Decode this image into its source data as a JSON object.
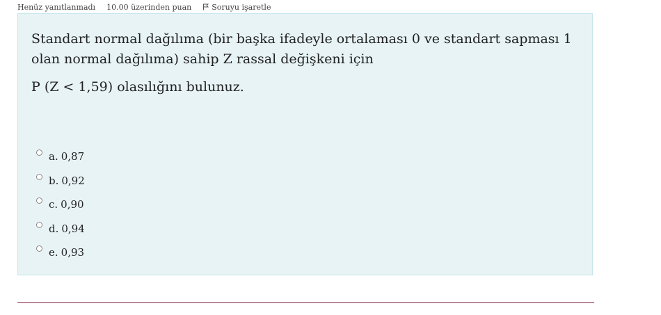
{
  "info": {
    "status": "Henüz yanıtlanmadı",
    "points": "10.00 üzerinden puan",
    "flag_label": "Soruyu işaretle"
  },
  "question": {
    "text": "Standart normal dağılıma (bir başka ifadeyle ortalaması 0 ve standart sapması 1 olan normal dağılıma) sahip Z rassal değişkeni için",
    "sub": "P (Z < 1,59) olasılığını bulunuz."
  },
  "answers": [
    {
      "prefix": "a.",
      "value": "0,87"
    },
    {
      "prefix": "b.",
      "value": "0,92"
    },
    {
      "prefix": "c.",
      "value": "0,90"
    },
    {
      "prefix": "d.",
      "value": "0,94"
    },
    {
      "prefix": "e.",
      "value": "0,93"
    }
  ],
  "colors": {
    "box_background": "#e7f3f5",
    "box_border": "#c8e6ea",
    "divider": "#7a1f3a"
  }
}
